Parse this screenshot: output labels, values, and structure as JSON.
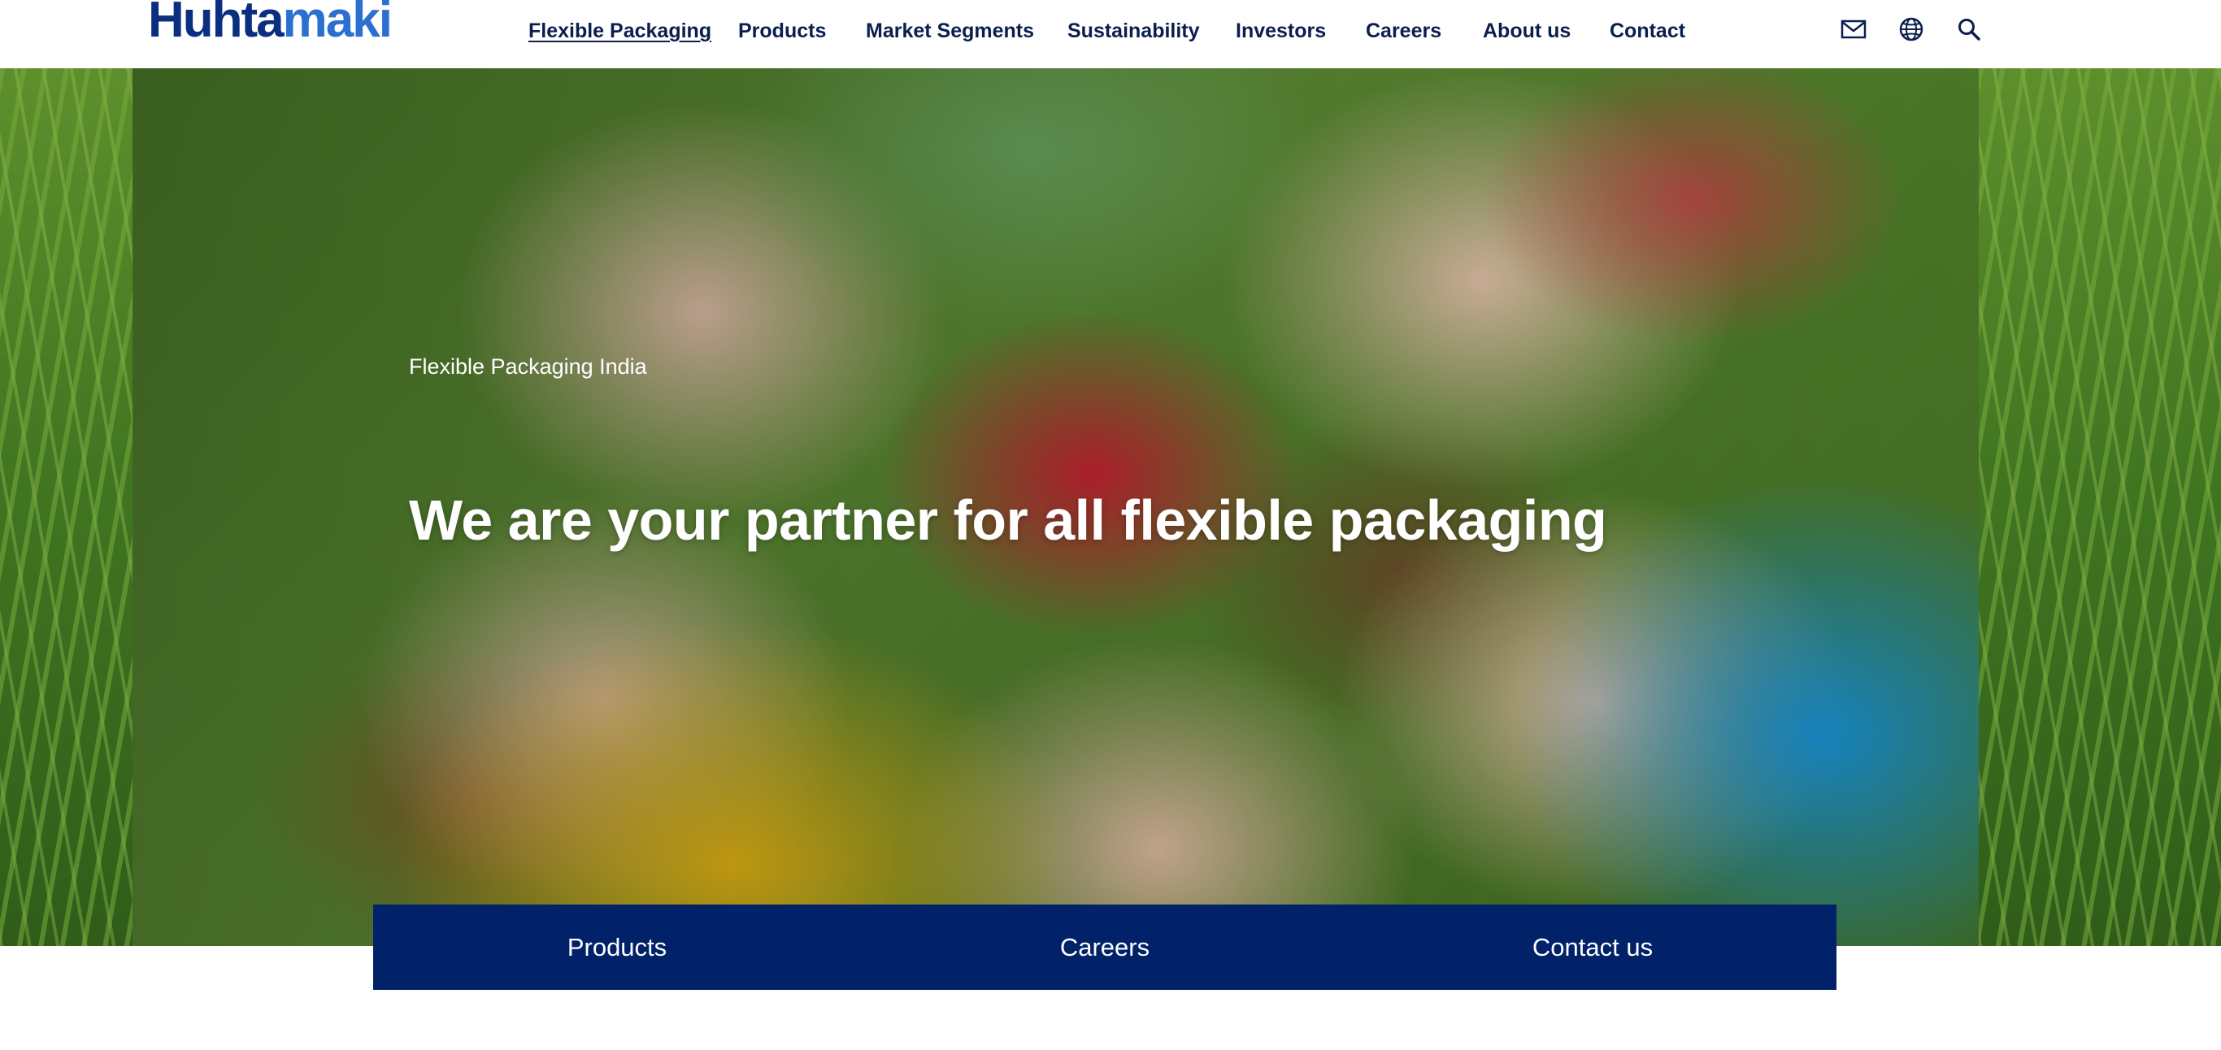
{
  "header": {
    "logo": {
      "part_a": "Huhta",
      "part_b": "maki"
    },
    "nav": [
      {
        "label": "Flexible Packaging",
        "active": true
      },
      {
        "label": "Products"
      },
      {
        "label": "Market Segments"
      },
      {
        "label": "Sustainability"
      },
      {
        "label": "Investors"
      },
      {
        "label": "Careers"
      },
      {
        "label": "About us"
      },
      {
        "label": "Contact"
      }
    ],
    "utility_icons": [
      "mail-icon",
      "globe-icon",
      "search-icon"
    ]
  },
  "hero": {
    "eyebrow": "Flexible Packaging India",
    "title": "We are your partner for all flexible packaging"
  },
  "quick_links": [
    {
      "label": "Products"
    },
    {
      "label": "Careers"
    },
    {
      "label": "Contact us"
    }
  ],
  "colors": {
    "brand_dark": "#0a2f80",
    "brand_light": "#2b6fd1",
    "nav_text": "#0a1f4e",
    "quick_bar_bg": "#012169"
  }
}
